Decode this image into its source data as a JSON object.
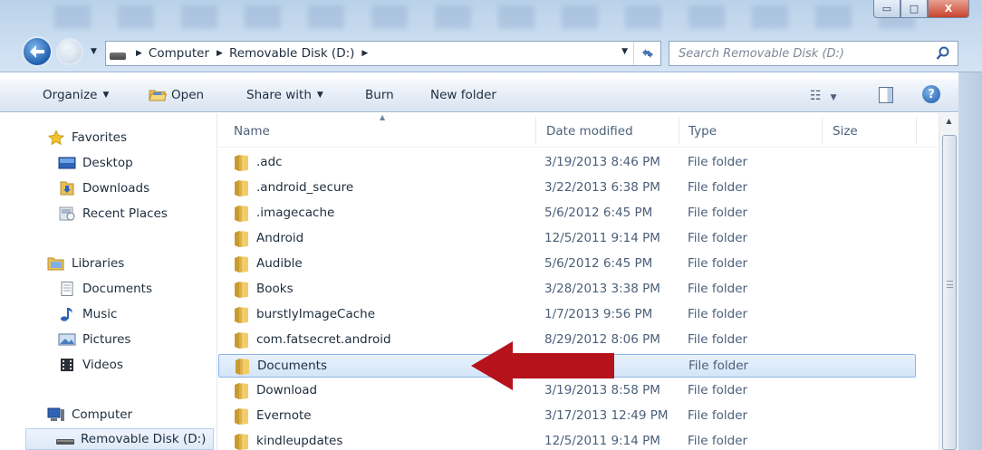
{
  "window": {
    "min_glyph": "▭",
    "max_glyph": "□",
    "close_glyph": "X"
  },
  "address": {
    "crumbs": [
      "Computer",
      "Removable Disk (D:)"
    ]
  },
  "search": {
    "placeholder": "Search Removable Disk (D:)"
  },
  "toolbar": {
    "organize": "Organize",
    "open": "Open",
    "share_with": "Share with",
    "burn": "Burn",
    "new_folder": "New folder"
  },
  "nav": {
    "favorites": {
      "header": "Favorites",
      "items": [
        "Desktop",
        "Downloads",
        "Recent Places"
      ]
    },
    "libraries": {
      "header": "Libraries",
      "items": [
        "Documents",
        "Music",
        "Pictures",
        "Videos"
      ]
    },
    "computer": {
      "header": "Computer",
      "items": [
        "Removable Disk (D:)"
      ]
    }
  },
  "columns": {
    "name": "Name",
    "date_modified": "Date modified",
    "type": "Type",
    "size": "Size"
  },
  "files": [
    {
      "name": ".adc",
      "date": "3/19/2013 8:46 PM",
      "type": "File folder"
    },
    {
      "name": ".android_secure",
      "date": "3/22/2013 6:38 PM",
      "type": "File folder"
    },
    {
      "name": ".imagecache",
      "date": "5/6/2012 6:45 PM",
      "type": "File folder"
    },
    {
      "name": "Android",
      "date": "12/5/2011 9:14 PM",
      "type": "File folder"
    },
    {
      "name": "Audible",
      "date": "5/6/2012 6:45 PM",
      "type": "File folder"
    },
    {
      "name": "Books",
      "date": "3/28/2013 3:38 PM",
      "type": "File folder"
    },
    {
      "name": "burstlyImageCache",
      "date": "1/7/2013 9:56 PM",
      "type": "File folder"
    },
    {
      "name": "com.fatsecret.android",
      "date": "8/29/2012 8:06 PM",
      "type": "File folder"
    },
    {
      "name": "Documents",
      "date": ":36 PM",
      "type": "File folder",
      "selected": true
    },
    {
      "name": "Download",
      "date": "3/19/2013 8:58 PM",
      "type": "File folder"
    },
    {
      "name": "Evernote",
      "date": "3/17/2013 12:49 PM",
      "type": "File folder"
    },
    {
      "name": "kindleupdates",
      "date": "12/5/2011 9:14 PM",
      "type": "File folder"
    }
  ],
  "colors": {
    "selection_bg": "#d9e8fa",
    "selection_border": "#8fb6e6",
    "arrow_red": "#b5121b",
    "folder_yellow": "#e9c15a"
  }
}
